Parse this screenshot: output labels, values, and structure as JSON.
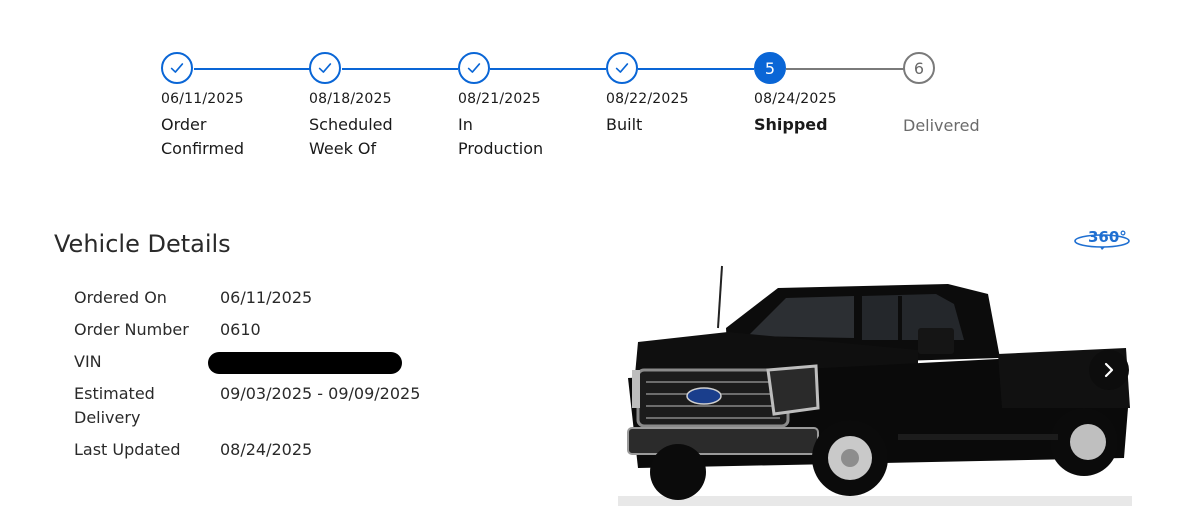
{
  "tracker": {
    "steps": [
      {
        "status": "complete",
        "date": "06/11/2025",
        "label": "Order Confirmed",
        "icon": "check-icon"
      },
      {
        "status": "complete",
        "date": "08/18/2025",
        "label": "Scheduled Week Of",
        "icon": "check-icon"
      },
      {
        "status": "complete",
        "date": "08/21/2025",
        "label": "In Production",
        "icon": "check-icon"
      },
      {
        "status": "complete",
        "date": "08/22/2025",
        "label": "Built",
        "icon": "check-icon"
      },
      {
        "status": "current",
        "number": "5",
        "date": "08/24/2025",
        "label": "Shipped"
      },
      {
        "status": "pending",
        "number": "6",
        "date": "",
        "label": "Delivered"
      }
    ],
    "colors": {
      "active": "#0a66d6",
      "pending": "#7a7a7a"
    }
  },
  "vehicle_details": {
    "title": "Vehicle Details",
    "rows": [
      {
        "key": "Ordered On",
        "value": "06/11/2025"
      },
      {
        "key": "Order Number",
        "value": "0610"
      },
      {
        "key": "VIN",
        "value": "",
        "redacted": true
      },
      {
        "key": "Estimated Delivery",
        "value": "09/03/2025 - 09/09/2025"
      },
      {
        "key": "Last Updated",
        "value": "08/24/2025"
      }
    ]
  },
  "viewer": {
    "view_360_label": "360°",
    "next_icon": "chevron-right-icon",
    "image_subject": "black-pickup-truck"
  }
}
